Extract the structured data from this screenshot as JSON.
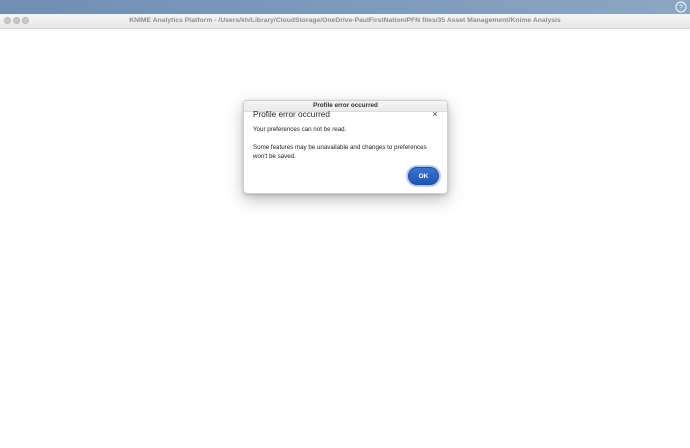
{
  "window": {
    "title": "KNIME Analytics Platform - /Users/kh/Library/CloudStorage/OneDrive-PaulFirstNation/PFN files/35 Asset Management/Knime Analysis"
  },
  "dialog": {
    "title": "Profile error occurred",
    "heading": "Profile error occurred",
    "close_glyph": "×",
    "message_line1": "Your preferences can not be read.",
    "message_line2": "Some features may be unavailable and changes to preferences won't be saved.",
    "ok_label": "OK"
  },
  "icons": {
    "desktop_corner": "help-icon",
    "dialog_close": "close-icon"
  },
  "colors": {
    "accent": "#1f56b6",
    "desktop": "#7f9cbd"
  }
}
